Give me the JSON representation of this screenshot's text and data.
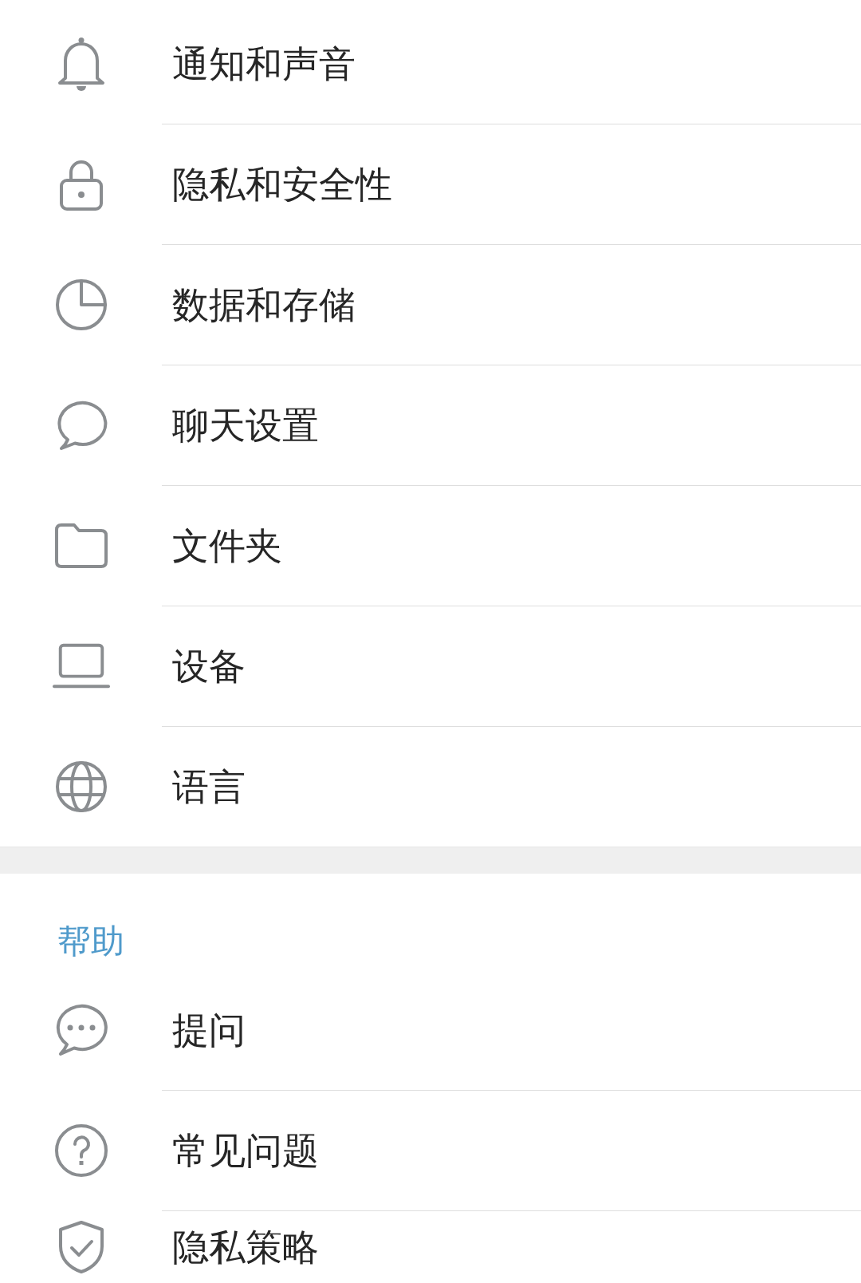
{
  "sections": [
    {
      "items": [
        "通知和声音",
        "隐私和安全性",
        "数据和存储",
        "聊天设置",
        "文件夹",
        "设备",
        "语言"
      ]
    },
    {
      "title": "帮助",
      "items": [
        "提问",
        "常见问题",
        "隐私策略"
      ]
    }
  ]
}
